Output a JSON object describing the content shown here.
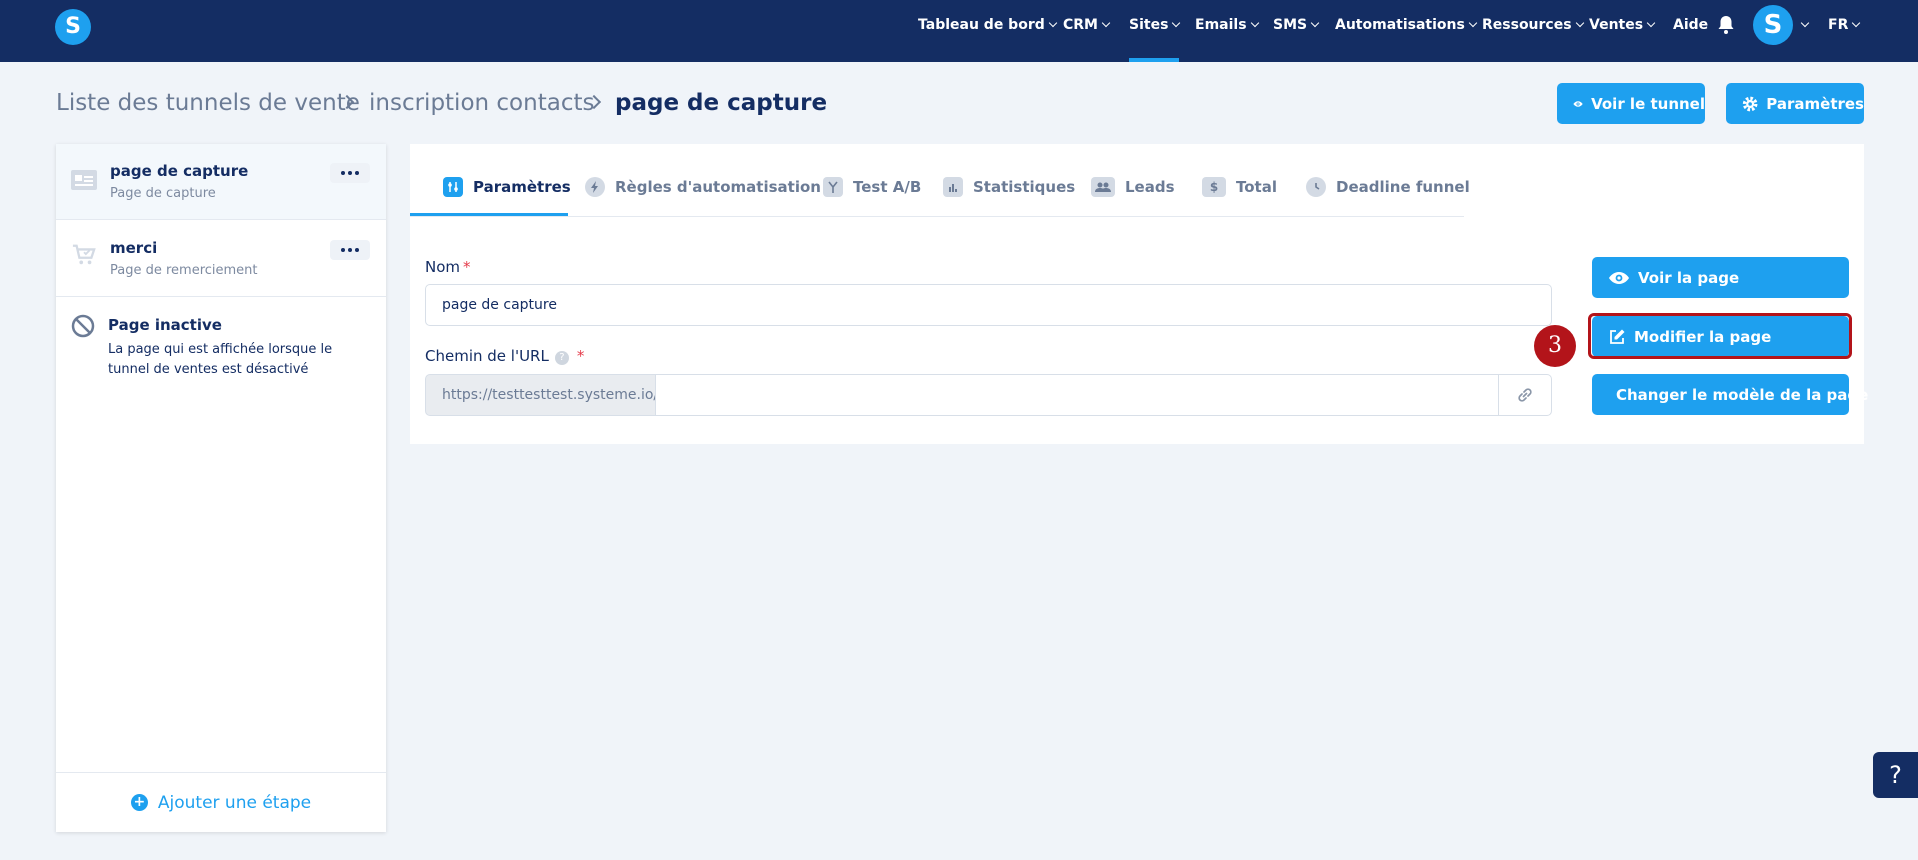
{
  "nav": {
    "items": [
      {
        "label": "Tableau de bord"
      },
      {
        "label": "CRM"
      },
      {
        "label": "Sites"
      },
      {
        "label": "Emails"
      },
      {
        "label": "SMS"
      },
      {
        "label": "Automatisations"
      },
      {
        "label": "Ressources"
      },
      {
        "label": "Ventes"
      }
    ],
    "aide": "Aide",
    "avatar": "S",
    "language": "FR",
    "logo": "S"
  },
  "breadcrumb": {
    "items": [
      "Liste des tunnels de vente",
      "inscription contacts"
    ],
    "current": "page de capture"
  },
  "header_buttons": {
    "view_funnel": "Voir le tunnel",
    "settings": "Paramètres"
  },
  "steps": [
    {
      "title": "page de capture",
      "subtitle": "Page de capture"
    },
    {
      "title": "merci",
      "subtitle": "Page de remerciement"
    }
  ],
  "inactive_page": {
    "title": "Page inactive",
    "description": "La page qui est affichée lorsque le tunnel de ventes est désactivé"
  },
  "add_step": "Ajouter une étape",
  "tabs": [
    {
      "label": "Paramètres"
    },
    {
      "label": "Règles d'automatisation"
    },
    {
      "label": "Test A/B"
    },
    {
      "label": "Statistiques"
    },
    {
      "label": "Leads"
    },
    {
      "label": "Total"
    },
    {
      "label": "Deadline funnel"
    }
  ],
  "form": {
    "name_label": "Nom",
    "name_value": "page de capture",
    "url_label": "Chemin de l'URL",
    "url_prefix": "https://testtesttest.systeme.io/",
    "url_value": "",
    "required_mark": "*"
  },
  "actions": {
    "view_page": "Voir la page",
    "edit_page": "Modifier la page",
    "change_template": "Changer le modèle de la page"
  },
  "annotation": {
    "step_number": "3"
  },
  "help": "?",
  "colors": {
    "navy": "#142d63",
    "accent": "#1ea0ef",
    "highlight": "#b3141a"
  }
}
